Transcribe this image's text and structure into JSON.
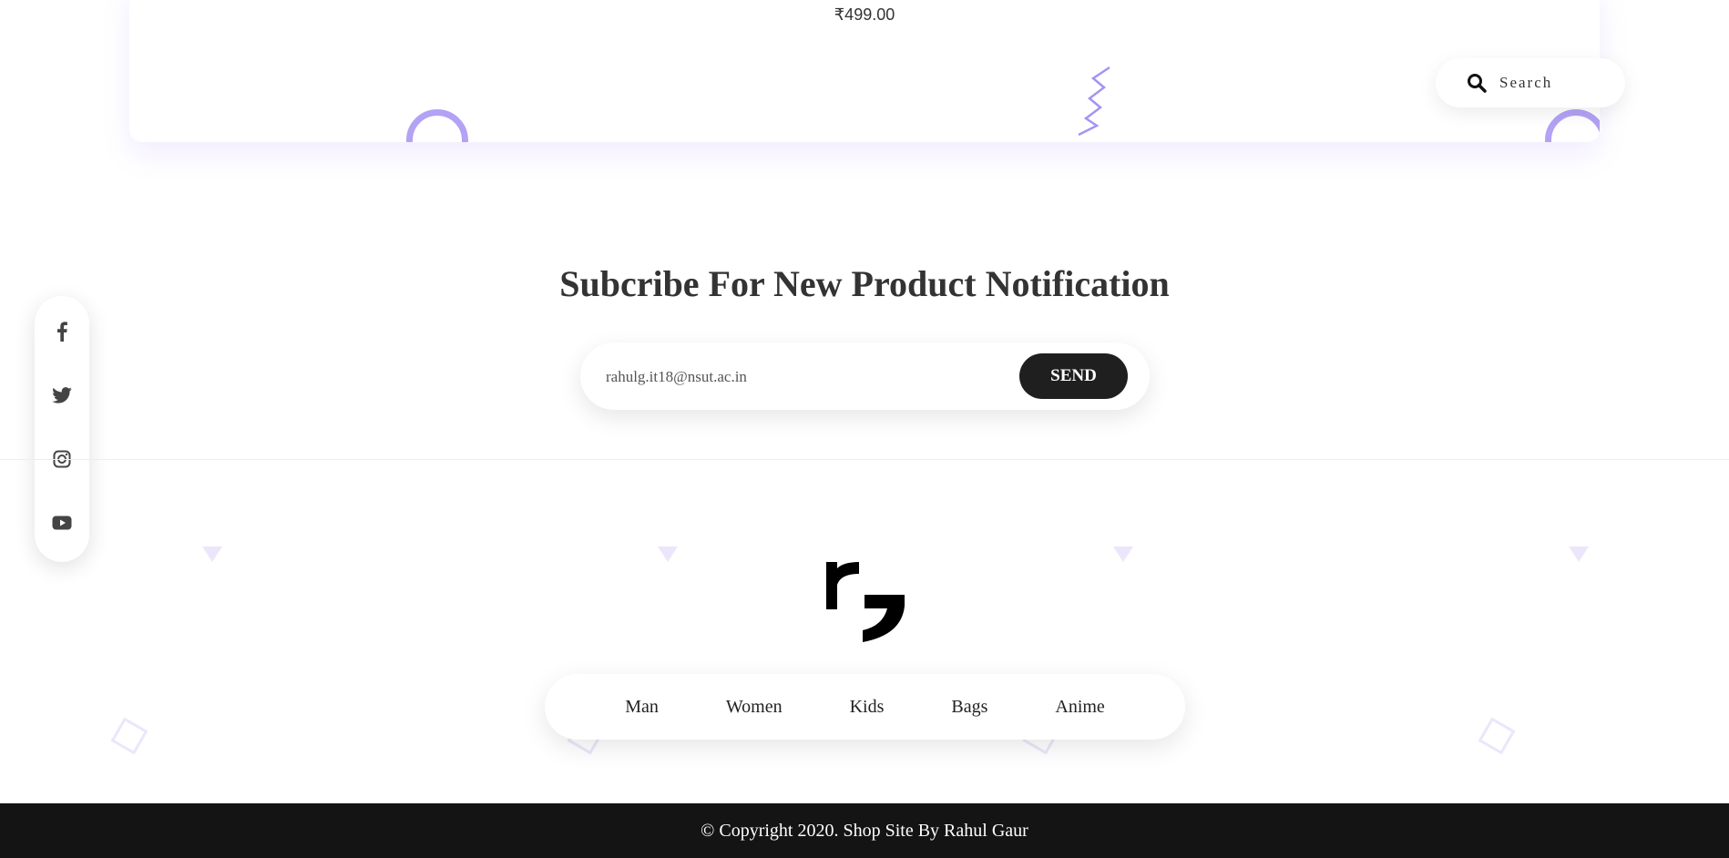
{
  "product": {
    "price": "₹499.00"
  },
  "search": {
    "label": "Search",
    "icon": "search-icon"
  },
  "social": {
    "items": [
      {
        "name": "facebook",
        "icon": "facebook-icon"
      },
      {
        "name": "twitter",
        "icon": "twitter-icon"
      },
      {
        "name": "instagram",
        "icon": "instagram-icon"
      },
      {
        "name": "youtube",
        "icon": "youtube-icon"
      }
    ]
  },
  "subscribe": {
    "title": "Subcribe For New Product Notification",
    "email_value": "rahulg.it18@nsut.ac.in",
    "send_label": "SEND"
  },
  "footer": {
    "logo": "rg-logo",
    "nav": [
      "Man",
      "Women",
      "Kids",
      "Bags",
      "Anime"
    ],
    "copyright": "© Copyright 2020. Shop Site By Rahul Gaur"
  },
  "colors": {
    "accent": "#b3a2f5",
    "decor_light": "#ece6fb",
    "dark": "#1f1f1f",
    "footer_bg": "#141414"
  }
}
